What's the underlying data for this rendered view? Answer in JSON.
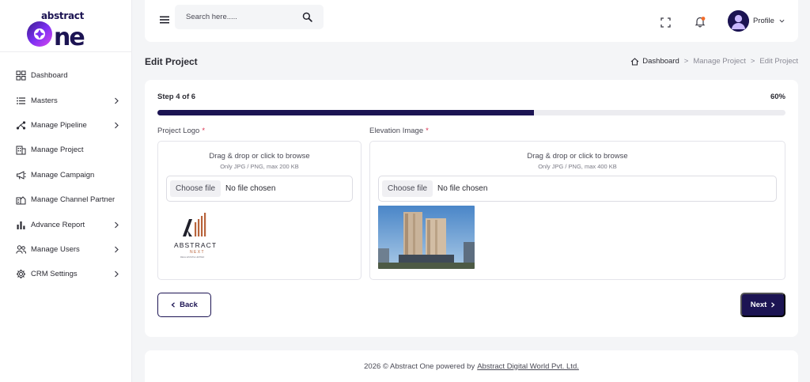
{
  "brand": {
    "name_top": "abstract",
    "name_main": "one"
  },
  "sidebar": {
    "items": [
      {
        "label": "Dashboard",
        "icon": "grid-icon",
        "has_children": false
      },
      {
        "label": "Masters",
        "icon": "list-icon",
        "has_children": true
      },
      {
        "label": "Manage Pipeline",
        "icon": "pipeline-icon",
        "has_children": true
      },
      {
        "label": "Manage Project",
        "icon": "building-icon",
        "has_children": false
      },
      {
        "label": "Manage Campaign",
        "icon": "megaphone-icon",
        "has_children": false
      },
      {
        "label": "Manage Channel Partner",
        "icon": "partner-icon",
        "has_children": false
      },
      {
        "label": "Advance Report",
        "icon": "bar-chart-icon",
        "has_children": true
      },
      {
        "label": "Manage Users",
        "icon": "users-icon",
        "has_children": true
      },
      {
        "label": "CRM Settings",
        "icon": "settings-icon",
        "has_children": true
      }
    ]
  },
  "header": {
    "search_placeholder": "Search here.....",
    "profile_label": "Profile"
  },
  "page": {
    "title": "Edit Project",
    "breadcrumb": [
      "Dashboard",
      "Manage Project",
      "Edit Project"
    ]
  },
  "wizard": {
    "step_text": "Step 4 of 6",
    "progress_percent": 60,
    "progress_text": "60%"
  },
  "fields": {
    "logo": {
      "label": "Project Logo",
      "required_mark": "*",
      "dropzone_title": "Drag & drop or click to browse",
      "dropzone_hint": "Only JPG / PNG, max 200 KB",
      "choose_label": "Choose file",
      "file_status": "No file chosen",
      "preview_text_main": "ABSTRACT",
      "preview_text_sub": "NEXT",
      "preview_text_tag": "REAL ESTATE LIMITED"
    },
    "elevation": {
      "label": "Elevation Image",
      "required_mark": "*",
      "dropzone_title": "Drag & drop or click to browse",
      "dropzone_hint": "Only JPG / PNG, max 400 KB",
      "choose_label": "Choose file",
      "file_status": "No file chosen"
    }
  },
  "actions": {
    "back_label": "Back",
    "next_label": "Next"
  },
  "footer": {
    "text": "2026 © Abstract One powered by",
    "link_text": "Abstract Digital World Pvt. Ltd."
  },
  "colors": {
    "primary": "#1c1453",
    "accent_orange": "#f26b2a",
    "required_red": "#d9304f",
    "background": "#f4f5f7"
  }
}
